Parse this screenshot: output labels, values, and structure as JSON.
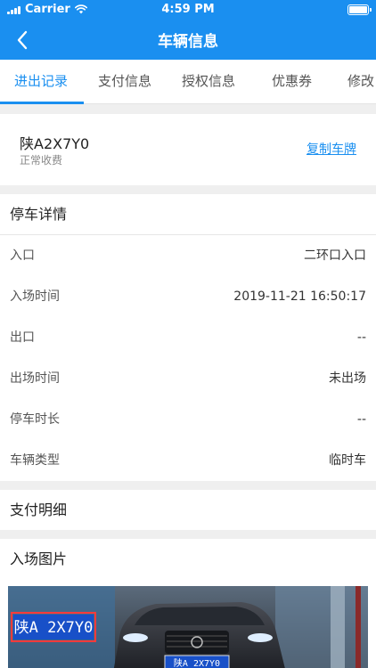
{
  "status_bar": {
    "carrier": "Carrier",
    "time": "4:59 PM"
  },
  "nav": {
    "title": "车辆信息",
    "back_icon": "chevron-left-icon"
  },
  "tabs": [
    {
      "label": "进出记录",
      "active": true
    },
    {
      "label": "支付信息",
      "active": false
    },
    {
      "label": "授权信息",
      "active": false
    },
    {
      "label": "优惠券",
      "active": false
    },
    {
      "label": "修改",
      "active": false
    }
  ],
  "vehicle": {
    "plate": "陕A2X7Y0",
    "charge_type": "正常收费",
    "copy_label": "复制车牌"
  },
  "parking_detail": {
    "title": "停车详情",
    "rows": [
      {
        "label": "入口",
        "value": "二环口入口"
      },
      {
        "label": "入场时间",
        "value": "2019-11-21 16:50:17"
      },
      {
        "label": "出口",
        "value": "--"
      },
      {
        "label": "出场时间",
        "value": "未出场"
      },
      {
        "label": "停车时长",
        "value": "--"
      },
      {
        "label": "车辆类型",
        "value": "临时车"
      }
    ]
  },
  "payment": {
    "title": "支付明细"
  },
  "entry_photo": {
    "title": "入场图片",
    "overlay_plate": "陕A 2X7Y0",
    "car_plate": "陕A 2X7Y0"
  },
  "colors": {
    "primary": "#1a8ff0",
    "background": "#efefef"
  }
}
